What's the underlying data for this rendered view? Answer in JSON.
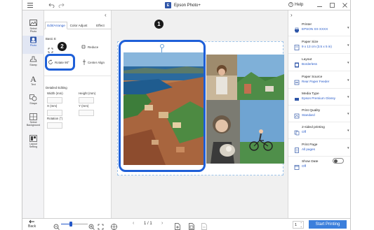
{
  "window": {
    "title": "Epson Photo+",
    "help_label": "Help"
  },
  "rail": {
    "items": [
      {
        "label": "Select\nPhoto"
      },
      {
        "label": "Photo"
      },
      {
        "label": "Stamp"
      },
      {
        "label": "Text"
      },
      {
        "label": "Shape"
      },
      {
        "label": "Select\nBackground"
      },
      {
        "label": "Layout\nSetting"
      }
    ],
    "back_label": "Back"
  },
  "panel": {
    "tabs": [
      "Edit/Arrange",
      "Color Adjust",
      "Effect"
    ],
    "basic_label": "Basic E",
    "reduce_label": "Reduce",
    "rotate_label": "Rotate 90°",
    "center_align_label": "Center Align",
    "detailed_label": "Detailed Editing",
    "width_label": "Width (mm)",
    "height_label": "Height (mm)",
    "x_label": "X (mm)",
    "y_label": "Y (mm)",
    "rotation_label": "Rotation (°)"
  },
  "settings": [
    {
      "label": "Printer",
      "value": "EPSON XX-XXXX",
      "icon": "printer-icon"
    },
    {
      "label": "Paper Size",
      "value": "9 x 13 cm (3.5 x 5 in)",
      "icon": "paper-size-icon"
    },
    {
      "label": "Layout",
      "value": "Borderless",
      "icon": "layout-icon"
    },
    {
      "label": "Paper Source",
      "value": "Rear Paper Feeder",
      "icon": "paper-source-icon"
    },
    {
      "label": "Media Type",
      "value": "Epson Premium Glossy",
      "icon": "media-type-icon"
    },
    {
      "label": "Print Quality",
      "value": "Standard",
      "icon": "print-quality-icon"
    },
    {
      "label": "2-sided printing",
      "value": "Off",
      "icon": "duplex-icon"
    },
    {
      "label": "Print Page",
      "value": "All pages",
      "icon": "print-page-icon"
    },
    {
      "label": "Show Date",
      "value": "Off",
      "icon": "date-icon"
    }
  ],
  "bottom": {
    "page_indicator": "1 / 1",
    "copies": "1",
    "start_label": "Start Printing"
  },
  "callouts": [
    "1",
    "2"
  ],
  "colors": {
    "accent": "#2458c9",
    "highlight": "#1e5fd8",
    "start_button": "#3b7fdc"
  }
}
